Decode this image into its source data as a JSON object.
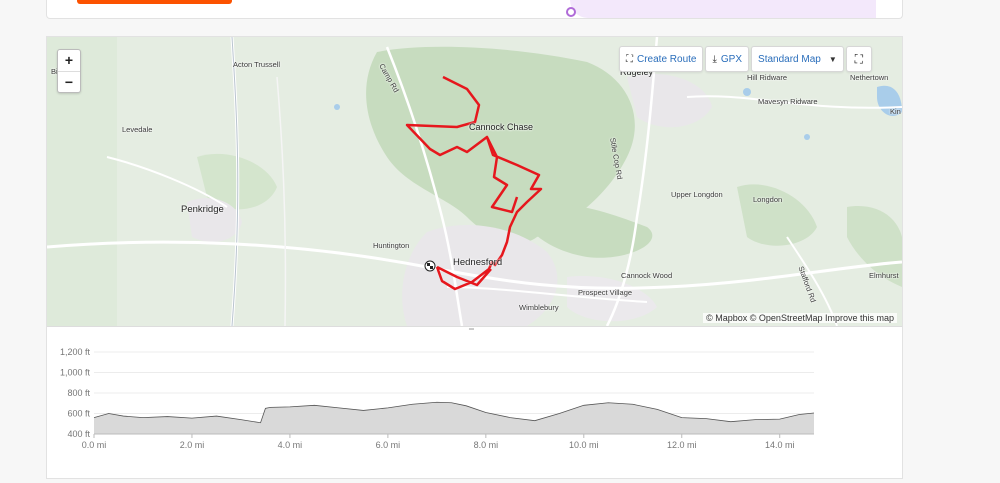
{
  "map": {
    "zoom_in": "+",
    "zoom_out": "−",
    "toolbar": {
      "create_route": "Create Route",
      "gpx": "GPX",
      "map_style": "Standard Map"
    },
    "attribution": "© Mapbox © OpenStreetMap Improve this map",
    "labels": {
      "acton_trussell": "Acton Trussell",
      "camp_rd": "Camp Rd",
      "rugeley": "Rugeley",
      "hill_ridware": "Hill Ridware",
      "nethertown": "Nethertown",
      "mavesyn_ridware": "Mavesyn Ridware",
      "kin": "Kin",
      "levedale": "Levedale",
      "cannock_chase": "Cannock Chase",
      "stile_cop_rd": "Stile Cop Rd",
      "upper_longdon": "Upper Longdon",
      "longdon": "Longdon",
      "penkridge": "Penkridge",
      "huntington": "Huntington",
      "hednesford": "Hednesford",
      "cannock_wood": "Cannock Wood",
      "elmhurst": "Elmhurst",
      "stafford_rd": "Stafford Rd",
      "prospect_village": "Prospect Village",
      "wimblebury": "Wimblebury",
      "bi": "Bi"
    }
  },
  "chart_data": {
    "type": "area",
    "title": "",
    "xlabel": "",
    "ylabel": "",
    "y_ticks": [
      "1,200 ft",
      "1,000 ft",
      "800 ft",
      "600 ft",
      "400 ft"
    ],
    "x_ticks": [
      "0.0 mi",
      "2.0 mi",
      "4.0 mi",
      "6.0 mi",
      "8.0 mi",
      "10.0 mi",
      "12.0 mi",
      "14.0 mi"
    ],
    "ylim": [
      400,
      1200
    ],
    "xlim": [
      0,
      14.7
    ],
    "fill_color": "#d9d9d9",
    "line_color": "#555555",
    "x": [
      0,
      0.3,
      0.6,
      1.0,
      1.5,
      2.0,
      2.5,
      3.0,
      3.4,
      3.5,
      3.6,
      4.0,
      4.5,
      5.0,
      5.5,
      6.0,
      6.5,
      7.0,
      7.3,
      7.6,
      8.0,
      8.5,
      9.0,
      9.5,
      10.0,
      10.5,
      11.0,
      11.5,
      12.0,
      12.5,
      13.0,
      13.5,
      14.0,
      14.4,
      14.7
    ],
    "y": [
      560,
      600,
      575,
      560,
      570,
      555,
      575,
      540,
      510,
      650,
      660,
      665,
      680,
      655,
      630,
      655,
      690,
      710,
      705,
      675,
      610,
      560,
      530,
      600,
      680,
      705,
      690,
      640,
      560,
      550,
      520,
      540,
      545,
      590,
      605
    ]
  }
}
